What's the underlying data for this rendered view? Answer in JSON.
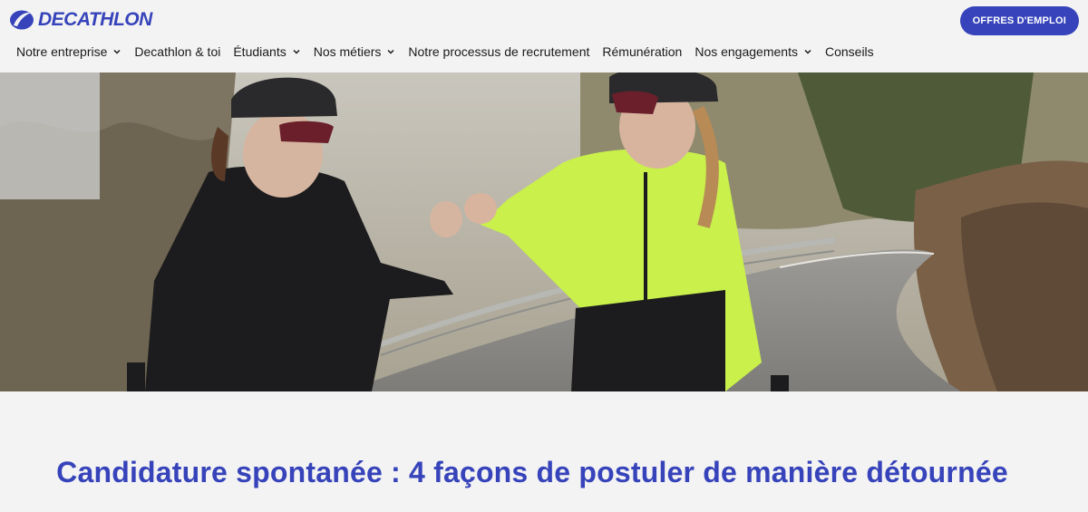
{
  "brand": {
    "name": "DECATHLON",
    "color": "#3643ba",
    "icon": "decathlon-swoosh-logo"
  },
  "header": {
    "cta_label": "OFFRES D'EMPLOI"
  },
  "nav": {
    "items": [
      {
        "label": "Notre entreprise",
        "dropdown": true
      },
      {
        "label": "Decathlon & toi",
        "dropdown": false
      },
      {
        "label": "Étudiants",
        "dropdown": true
      },
      {
        "label": "Nos métiers",
        "dropdown": true
      },
      {
        "label": "Notre processus de recrutement",
        "dropdown": false
      },
      {
        "label": "Rémunération",
        "dropdown": false
      },
      {
        "label": "Nos engagements",
        "dropdown": true
      },
      {
        "label": "Conseils",
        "dropdown": false
      }
    ],
    "dropdown_icon": "chevron-down-icon"
  },
  "hero": {
    "image": "two-cyclists-fist-bump-photo"
  },
  "article": {
    "title": "Candidature spontanée : 4 façons de postuler de manière détournée"
  }
}
